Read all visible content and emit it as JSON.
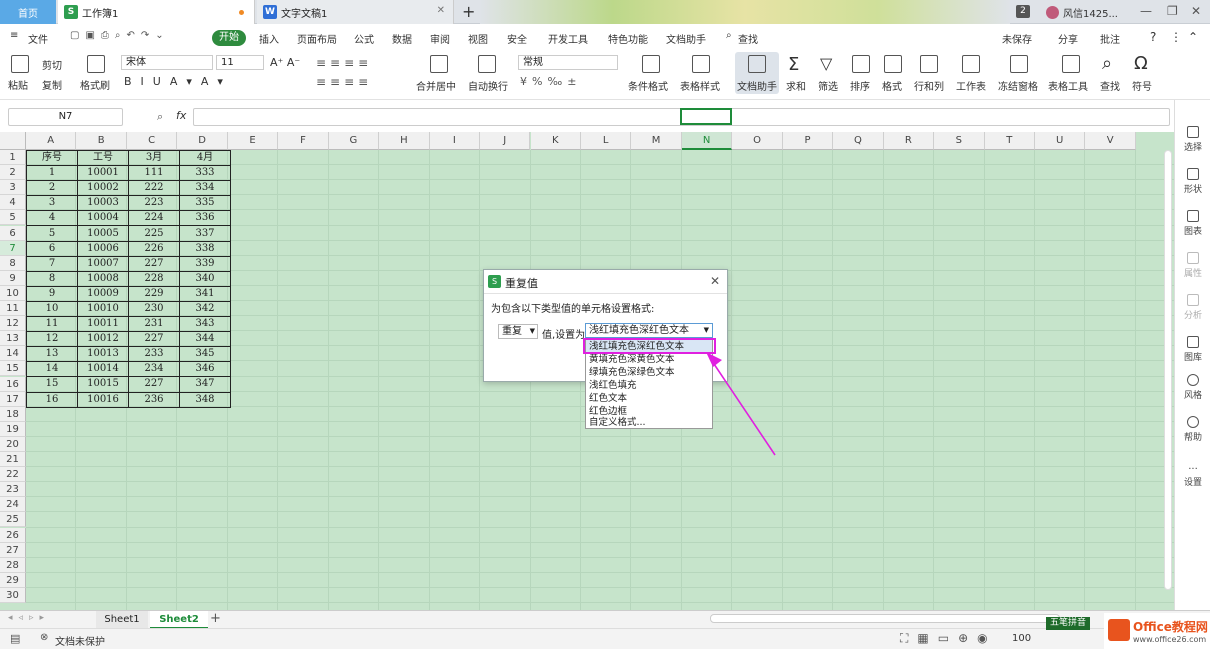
{
  "titlebar": {
    "home": "首页",
    "tabs": [
      {
        "label": "工作簿1",
        "icon": "S"
      },
      {
        "label": "文字文稿1",
        "icon": "W"
      }
    ],
    "badge": "2",
    "user": "风信1425..."
  },
  "menu": {
    "file": "文件",
    "items": [
      "开始",
      "插入",
      "页面布局",
      "公式",
      "数据",
      "审阅",
      "视图",
      "安全",
      "开发工具",
      "特色功能",
      "文档助手"
    ],
    "search": "查找",
    "right": [
      "未保存",
      "分享",
      "批注"
    ]
  },
  "ribbon": {
    "paste": "粘贴",
    "cut": "剪切",
    "copy": "复制",
    "format_painter": "格式刷",
    "font": "宋体",
    "font_size": "11",
    "number_format": "常规",
    "merge": "合并居中",
    "wrap": "自动换行",
    "tools": [
      "条件格式",
      "表格样式",
      "文档助手",
      "求和",
      "筛选",
      "排序",
      "格式",
      "行和列",
      "工作表",
      "冻结窗格",
      "表格工具",
      "查找",
      "符号"
    ]
  },
  "formula": {
    "namebox": "N7",
    "fx": "fx"
  },
  "columns": [
    "A",
    "B",
    "C",
    "D",
    "E",
    "F",
    "G",
    "H",
    "I",
    "J",
    "K",
    "L",
    "M",
    "N",
    "O",
    "P",
    "Q",
    "R",
    "S",
    "T",
    "U",
    "V"
  ],
  "rows": [
    "1",
    "2",
    "3",
    "4",
    "5",
    "6",
    "7",
    "8",
    "9",
    "10",
    "11",
    "12",
    "13",
    "14",
    "15",
    "16",
    "17",
    "18",
    "19",
    "20",
    "21",
    "22",
    "23",
    "24",
    "25",
    "26",
    "27",
    "28",
    "29",
    "30"
  ],
  "table": {
    "headers": [
      "序号",
      "工号",
      "3月",
      "4月"
    ],
    "rows": [
      [
        "1",
        "10001",
        "111",
        "333"
      ],
      [
        "2",
        "10002",
        "222",
        "334"
      ],
      [
        "3",
        "10003",
        "223",
        "335"
      ],
      [
        "4",
        "10004",
        "224",
        "336"
      ],
      [
        "5",
        "10005",
        "225",
        "337"
      ],
      [
        "6",
        "10006",
        "226",
        "338"
      ],
      [
        "7",
        "10007",
        "227",
        "339"
      ],
      [
        "8",
        "10008",
        "228",
        "340"
      ],
      [
        "9",
        "10009",
        "229",
        "341"
      ],
      [
        "10",
        "10010",
        "230",
        "342"
      ],
      [
        "11",
        "10011",
        "231",
        "343"
      ],
      [
        "12",
        "10012",
        "227",
        "344"
      ],
      [
        "13",
        "10013",
        "233",
        "345"
      ],
      [
        "14",
        "10014",
        "234",
        "346"
      ],
      [
        "15",
        "10015",
        "227",
        "347"
      ],
      [
        "16",
        "10016",
        "236",
        "348"
      ]
    ]
  },
  "dialog": {
    "title": "重复值",
    "prompt": "为包含以下类型值的单元格设置格式:",
    "kind": "重复",
    "set_as": "值,设置为",
    "selected": "浅红填充色深红色文本",
    "options": [
      "浅红填充色深红色文本",
      "黄填充色深黄色文本",
      "绿填充色深绿色文本",
      "浅红色填充",
      "红色文本",
      "红色边框",
      "自定义格式..."
    ]
  },
  "right_panel": [
    "选择",
    "形状",
    "图表",
    "属性",
    "分析",
    "图库",
    "风格",
    "帮助",
    "设置"
  ],
  "sheets": [
    "Sheet1",
    "Sheet2"
  ],
  "status": {
    "protect": "文档未保护",
    "zoom": "100",
    "ime": "五笔拼音"
  },
  "logo": {
    "brand": "Office教程网",
    "url": "www.office26.com"
  },
  "colors": {
    "accent": "#2e8b3e",
    "grid_bg": "#c6e4cb",
    "highlight": "#e020e0"
  }
}
